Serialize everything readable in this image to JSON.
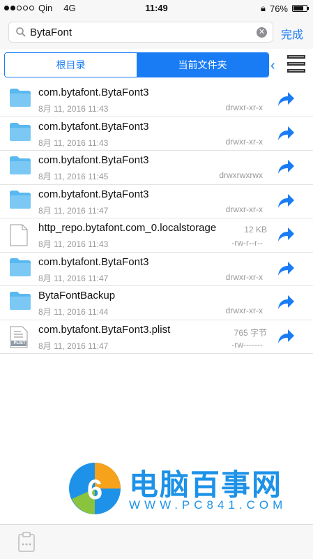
{
  "status_bar": {
    "carrier": "Qin",
    "network": "4G",
    "time": "11:49",
    "battery": "76%",
    "battery_level": 0.76
  },
  "search": {
    "value": "BytaFont",
    "done_label": "完成"
  },
  "segments": {
    "root": "根目录",
    "current": "当前文件夹"
  },
  "files": [
    {
      "name": "com.bytafont.BytaFont3",
      "date": "8月 11, 2016 11:43",
      "perm": "drwxr-xr-x",
      "size": "",
      "type": "folder"
    },
    {
      "name": "com.bytafont.BytaFont3",
      "date": "8月 11, 2016 11:43",
      "perm": "drwxr-xr-x",
      "size": "",
      "type": "folder"
    },
    {
      "name": "com.bytafont.BytaFont3",
      "date": "8月 11, 2016 11:45",
      "perm": "drwxrwxrwx",
      "size": "",
      "type": "folder"
    },
    {
      "name": "com.bytafont.BytaFont3",
      "date": "8月 11, 2016 11:47",
      "perm": "drwxr-xr-x",
      "size": "",
      "type": "folder"
    },
    {
      "name": "http_repo.bytafont.com_0.localstorage",
      "date": "8月 11, 2016 11:43",
      "perm": "-rw-r--r--",
      "size": "12 KB",
      "type": "file"
    },
    {
      "name": "com.bytafont.BytaFont3",
      "date": "8月 11, 2016 11:47",
      "perm": "drwxr-xr-x",
      "size": "",
      "type": "folder"
    },
    {
      "name": "BytaFontBackup",
      "date": "8月 11, 2016 11:44",
      "perm": "drwxr-xr-x",
      "size": "",
      "type": "folder"
    },
    {
      "name": "com.bytafont.BytaFont3.plist",
      "date": "8月 11, 2016 11:47",
      "perm": "-rw-------",
      "size": "765 字节",
      "type": "plist",
      "icon_text": "PLIST"
    }
  ],
  "watermark": {
    "title": "电脑百事网",
    "url": "WWW.PC841.COM"
  },
  "colors": {
    "accent": "#1a7cf5",
    "folder": "#5ab8f0"
  }
}
